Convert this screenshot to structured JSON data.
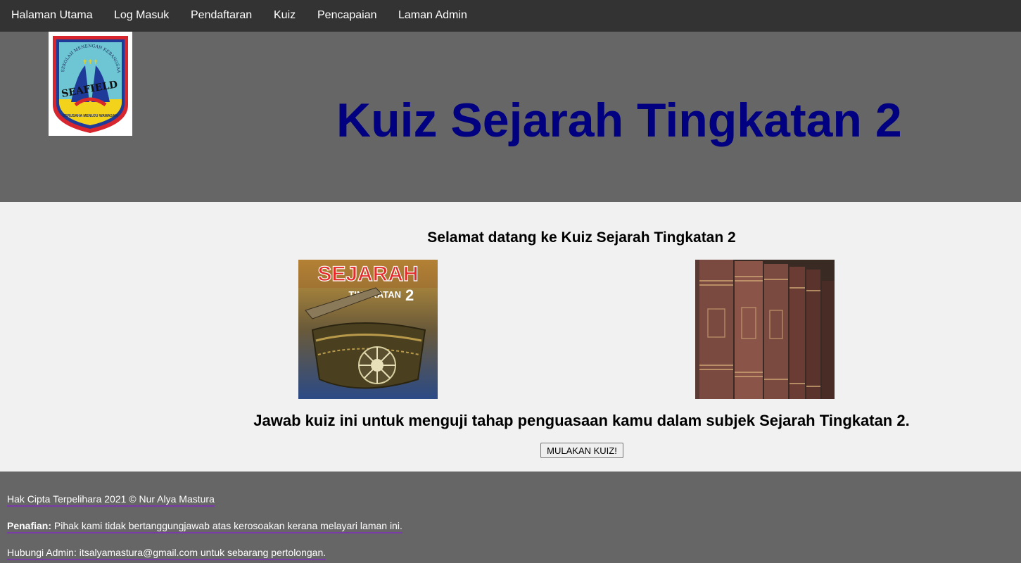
{
  "nav": {
    "items": [
      {
        "label": "Halaman Utama"
      },
      {
        "label": "Log Masuk"
      },
      {
        "label": "Pendaftaran"
      },
      {
        "label": "Kuiz"
      },
      {
        "label": "Pencapaian"
      },
      {
        "label": "Laman Admin"
      }
    ]
  },
  "header": {
    "title": "Kuiz Sejarah Tingkatan 2",
    "logo": {
      "arc_text": "SEKOLAH MENENGAH KEBANGSAAN",
      "name": "SEAFIELD",
      "motto": "BERUSAHA MENUJU WAWASAN"
    }
  },
  "main": {
    "welcome": "Selamat datang ke Kuiz Sejarah Tingkatan 2",
    "book_cover": {
      "title": "SEJARAH",
      "subtitle": "TINGKATAN",
      "number": "2"
    },
    "tagline": "Jawab kuiz ini untuk menguji tahap penguasaan kamu dalam subjek Sejarah Tingkatan 2.",
    "start_button": "MULAKAN KUIZ!"
  },
  "footer": {
    "copyright": "Hak Cipta Terpelihara 2021 © Nur Alya Mastura",
    "disclaimer_label": "Penafian:",
    "disclaimer_text": " Pihak kami tidak bertanggungjawab atas kerosoakan kerana melayari laman ini.",
    "contact": "Hubungi Admin: itsalyamastura@gmail.com untuk sebarang pertolongan."
  },
  "colors": {
    "nav_bg": "#333333",
    "header_bg": "#666666",
    "title": "#000080",
    "main_bg": "#f1f1f1",
    "link_underline": "#7a3aa8"
  }
}
